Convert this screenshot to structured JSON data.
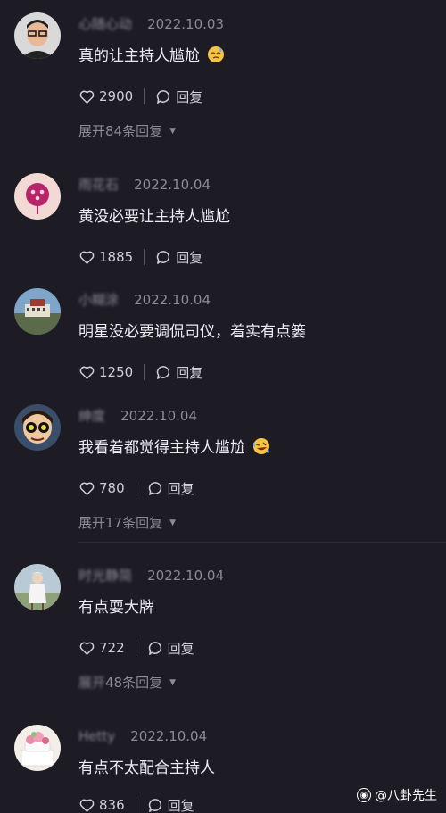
{
  "comments": [
    {
      "username": "心随心动",
      "date": "2022.10.03",
      "text": "真的让主持人尴尬",
      "emoji": "sweat-face-emoji",
      "likes": "2900",
      "reply_label": "回复",
      "expand_label": "展开84条回复"
    },
    {
      "username": "雨花石",
      "date": "2022.10.04",
      "text": "黄没必要让主持人尴尬",
      "likes": "1885",
      "reply_label": "回复"
    },
    {
      "username": "小糊涂",
      "date": "2022.10.04",
      "text": "明星没必要调侃司仪，着实有点篓",
      "likes": "1250",
      "reply_label": "回复"
    },
    {
      "username": "绅度",
      "date": "2022.10.04",
      "text": "我看着都觉得主持人尴尬",
      "emoji": "rofl-face-emoji",
      "likes": "780",
      "reply_label": "回复",
      "expand_label": "展开17条回复"
    },
    {
      "username": "时光静简",
      "date": "2022.10.04",
      "text": "有点耍大牌",
      "likes": "722",
      "reply_label": "回复",
      "expand_label_hidden": "展开",
      "expand_label": "48条回复"
    },
    {
      "username": "Hetty",
      "date": "2022.10.04",
      "text": "有点不太配合主持人",
      "likes": "836",
      "reply_label": "回复"
    }
  ],
  "watermark": {
    "text": "@八卦先生"
  },
  "colors": {
    "background": "#1d1c25",
    "secondary_text": "#8c8b95",
    "primary_text": "#ececf0"
  }
}
